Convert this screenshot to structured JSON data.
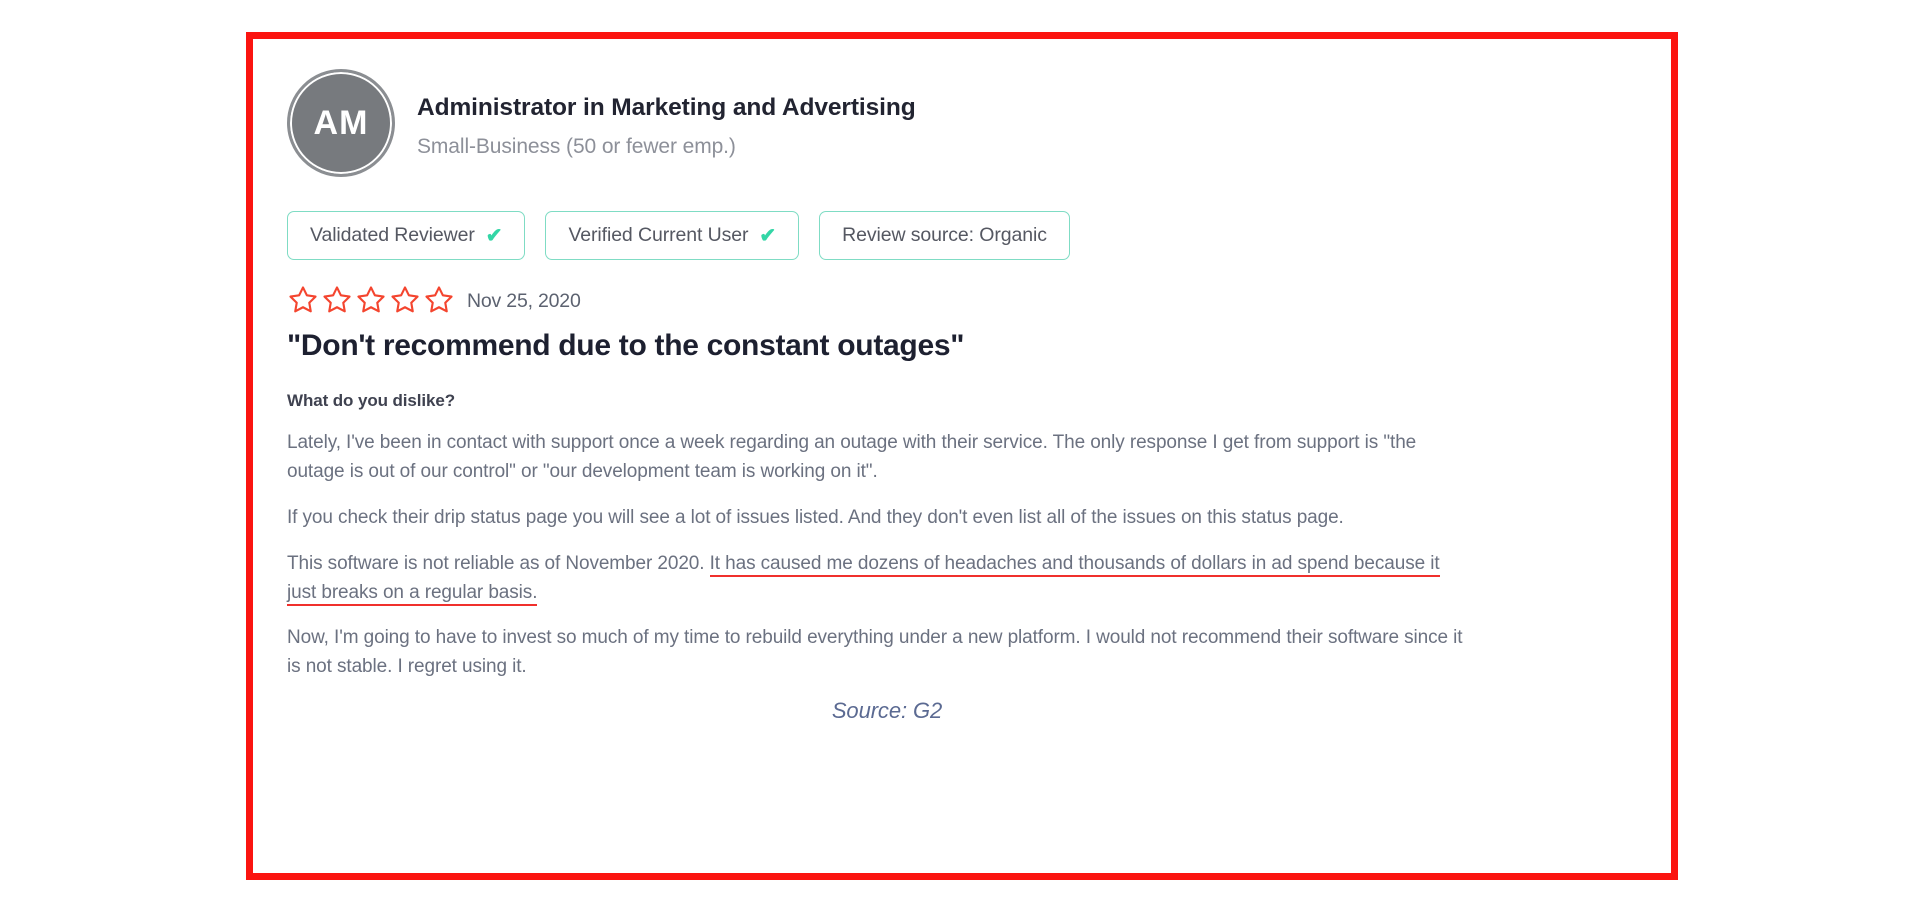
{
  "frame": {
    "border_color": "#fb1410"
  },
  "reviewer": {
    "avatar_initials": "AM",
    "title": "Administrator in Marketing and Advertising",
    "company_size": "Small-Business (50 or fewer emp.)"
  },
  "badges": [
    {
      "label": "Validated Reviewer",
      "check": "✔",
      "has_check": true
    },
    {
      "label": "Verified Current User",
      "check": "✔",
      "has_check": true
    },
    {
      "label": "Review source: Organic",
      "check": "",
      "has_check": false
    }
  ],
  "rating": {
    "value": 0,
    "max": 5,
    "star_color": "#f4452f",
    "filled": [
      false,
      false,
      false,
      false,
      false
    ],
    "date": "Nov 25, 2020"
  },
  "review": {
    "title": "\"Don't recommend due to the constant outages\"",
    "question": "What do you dislike?",
    "paragraphs": [
      {
        "text": "Lately, I've been in contact with support once a week regarding an outage with their service. The only response I get from support is \"the outage is out of our control\" or \"our development team is working on it\".",
        "highlight": ""
      },
      {
        "text": "If you check their drip status page you will see a lot of issues listed. And they don't even list all of the issues on this status page.",
        "highlight": ""
      },
      {
        "text": "This software is not reliable as of November 2020. ",
        "highlight": "It has caused me dozens of headaches and thousands of dollars in ad spend because it just breaks on a regular basis."
      },
      {
        "text": "Now, I'm going to have to invest so much of my time to rebuild everything under a new platform. I would not recommend their software since it is not stable. I regret using it.",
        "highlight": ""
      }
    ]
  },
  "source": {
    "label": "Source: G2"
  }
}
